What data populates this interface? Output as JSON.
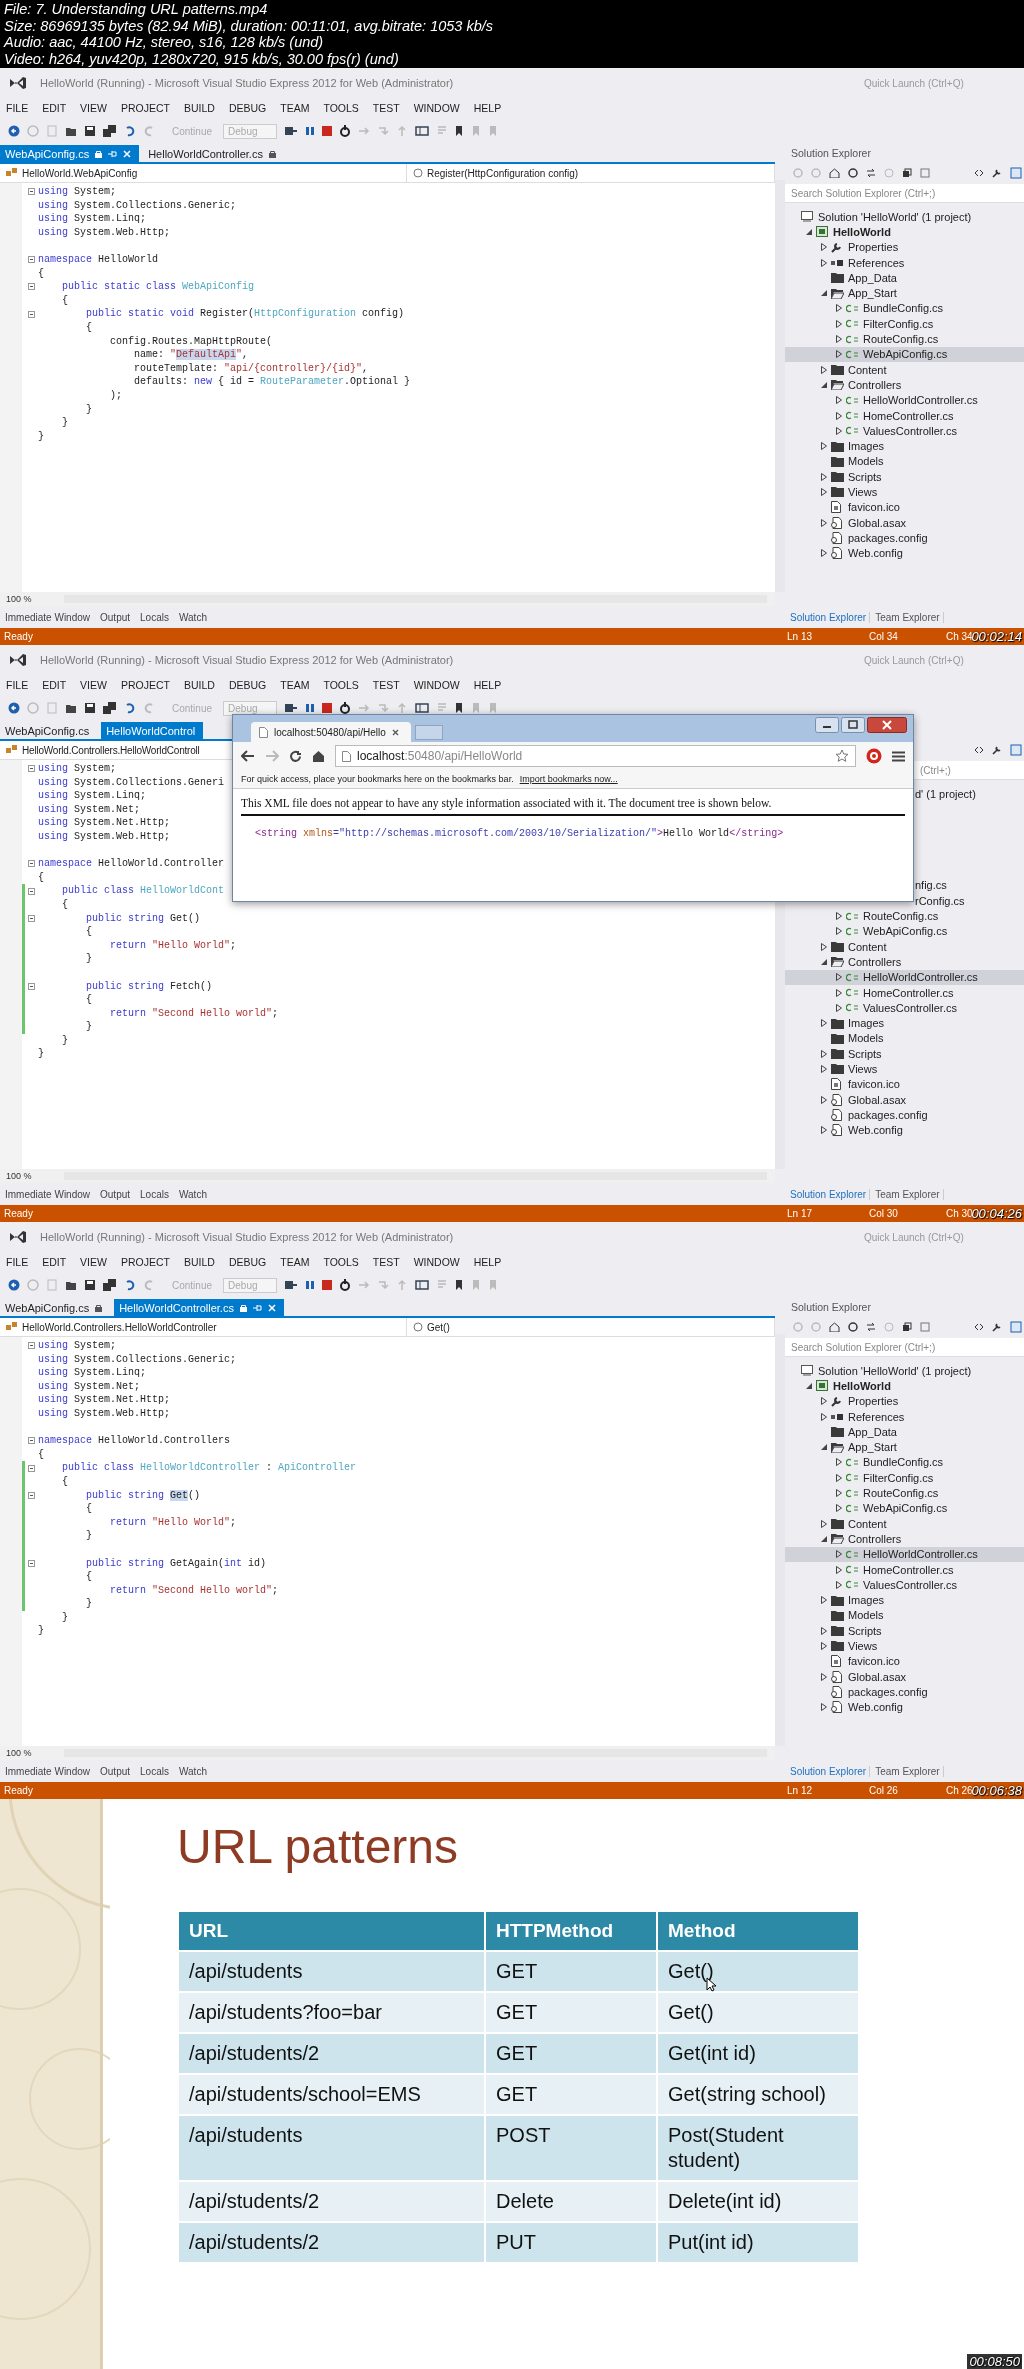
{
  "file_info": [
    "File: 7. Understanding URL patterns.mp4",
    "Size: 86969135 bytes (82.94 MiB), duration: 00:11:01, avg.bitrate: 1053 kb/s",
    "Audio: aac, 44100 Hz, stereo, s16, 128 kb/s (und)",
    "Video: h264, yuv420p, 1280x720, 915 kb/s, 30.00 fps(r) (und)"
  ],
  "frames": [
    {
      "title": "HelloWorld (Running) - Microsoft Visual Studio Express 2012 for Web (Administrator)",
      "quick_launch": {
        "placeholder": "Quick Launch (Ctrl+Q)"
      },
      "menu": [
        "FILE",
        "EDIT",
        "VIEW",
        "PROJECT",
        "BUILD",
        "DEBUG",
        "TEAM",
        "TOOLS",
        "TEST",
        "WINDOW",
        "HELP"
      ],
      "toolbar": {
        "continue": "Continue",
        "configuration": "Debug"
      },
      "tabs": [
        {
          "label": "WebApiConfig.cs",
          "selected": true
        },
        {
          "label": "HelloWorldController.cs",
          "selected": false
        }
      ],
      "nav": {
        "type": "HelloWorld.WebApiConfig",
        "member": "Register(HttpConfiguration config)"
      },
      "code": [
        {
          "kind": "code",
          "fold": true,
          "changed": false,
          "tokens": [
            {
              "kind": "keyword",
              "text": "using"
            },
            {
              "kind": "plain",
              "text": " System;"
            }
          ]
        },
        {
          "kind": "code",
          "fold": false,
          "changed": false,
          "tokens": [
            {
              "kind": "keyword",
              "text": "using"
            },
            {
              "kind": "plain",
              "text": " System.Collections.Generic;"
            }
          ]
        },
        {
          "kind": "code",
          "fold": false,
          "changed": false,
          "tokens": [
            {
              "kind": "keyword",
              "text": "using"
            },
            {
              "kind": "plain",
              "text": " System.Linq;"
            }
          ]
        },
        {
          "kind": "code",
          "fold": false,
          "changed": false,
          "tokens": [
            {
              "kind": "keyword",
              "text": "using"
            },
            {
              "kind": "plain",
              "text": " System.Web.Http;"
            }
          ]
        },
        {
          "kind": "blank",
          "changed": false
        },
        {
          "kind": "code",
          "fold": true,
          "changed": false,
          "tokens": [
            {
              "kind": "keyword",
              "text": "namespace"
            },
            {
              "kind": "plain",
              "text": " HelloWorld"
            }
          ]
        },
        {
          "kind": "code",
          "fold": false,
          "changed": false,
          "tokens": [
            {
              "kind": "plain",
              "text": "{"
            }
          ]
        },
        {
          "kind": "code",
          "fold": true,
          "changed": false,
          "tokens": [
            {
              "kind": "keyword",
              "text": "    public static class"
            },
            {
              "kind": "type",
              "text": " WebApiConfig"
            }
          ]
        },
        {
          "kind": "code",
          "fold": false,
          "changed": false,
          "tokens": [
            {
              "kind": "plain",
              "text": "    {"
            }
          ]
        },
        {
          "kind": "code",
          "fold": true,
          "changed": false,
          "tokens": [
            {
              "kind": "keyword",
              "text": "        public static void"
            },
            {
              "kind": "plain",
              "text": " Register("
            },
            {
              "kind": "type",
              "text": "HttpConfiguration"
            },
            {
              "kind": "plain",
              "text": " config)"
            }
          ]
        },
        {
          "kind": "code",
          "fold": false,
          "changed": false,
          "tokens": [
            {
              "kind": "plain",
              "text": "        {"
            }
          ]
        },
        {
          "kind": "code",
          "fold": false,
          "changed": false,
          "tokens": [
            {
              "kind": "plain",
              "text": "            config.Routes.MapHttpRoute("
            }
          ]
        },
        {
          "kind": "code",
          "fold": false,
          "changed": false,
          "tokens": [
            {
              "kind": "plain",
              "text": "                name: "
            },
            {
              "kind": "string",
              "text": "\""
            },
            {
              "kind": "string_highlight",
              "text": "DefaultApi"
            },
            {
              "kind": "string",
              "text": "\""
            },
            {
              "kind": "plain",
              "text": ","
            }
          ]
        },
        {
          "kind": "code",
          "fold": false,
          "changed": false,
          "tokens": [
            {
              "kind": "plain",
              "text": "                routeTemplate: "
            },
            {
              "kind": "string",
              "text": "\"api/{controller}/{id}\""
            },
            {
              "kind": "plain",
              "text": ","
            }
          ]
        },
        {
          "kind": "code",
          "fold": false,
          "changed": false,
          "tokens": [
            {
              "kind": "plain",
              "text": "                defaults: "
            },
            {
              "kind": "keyword",
              "text": "new"
            },
            {
              "kind": "plain",
              "text": " { id = "
            },
            {
              "kind": "type",
              "text": "RouteParameter"
            },
            {
              "kind": "plain",
              "text": ".Optional }"
            }
          ]
        },
        {
          "kind": "code",
          "fold": false,
          "changed": false,
          "tokens": [
            {
              "kind": "plain",
              "text": "            );"
            }
          ]
        },
        {
          "kind": "code",
          "fold": false,
          "changed": false,
          "tokens": [
            {
              "kind": "plain",
              "text": "        }"
            }
          ]
        },
        {
          "kind": "code",
          "fold": false,
          "changed": false,
          "tokens": [
            {
              "kind": "plain",
              "text": "    }"
            }
          ]
        },
        {
          "kind": "code",
          "fold": false,
          "changed": false,
          "tokens": [
            {
              "kind": "plain",
              "text": "}"
            }
          ]
        }
      ],
      "zoom": "100 %",
      "bottom_tabs": [
        "Immediate Window",
        "Output",
        "Locals",
        "Watch"
      ],
      "solution_explorer": {
        "title": "Solution Explorer",
        "search": {
          "placeholder": "Search Solution Explorer (Ctrl+;)"
        },
        "tree": [
          {
            "label": "Solution 'HelloWorld' (1 project)",
            "kind": "solution",
            "selected": false,
            "children": [
              {
                "label": "HelloWorld",
                "kind": "project",
                "expanded": true,
                "selected": false,
                "children": [
                  {
                    "label": "Properties",
                    "kind": "wrench",
                    "expanded": false,
                    "selected": false
                  },
                  {
                    "label": "References",
                    "kind": "references",
                    "expanded": false,
                    "selected": false
                  },
                  {
                    "label": "App_Data",
                    "kind": "folder",
                    "selected": false
                  },
                  {
                    "label": "App_Start",
                    "kind": "folder_open",
                    "expanded": true,
                    "selected": false,
                    "children": [
                      {
                        "label": "BundleConfig.cs",
                        "kind": "cs",
                        "expanded": false,
                        "selected": false
                      },
                      {
                        "label": "FilterConfig.cs",
                        "kind": "cs",
                        "expanded": false,
                        "selected": false
                      },
                      {
                        "label": "RouteConfig.cs",
                        "kind": "cs",
                        "expanded": false,
                        "selected": false
                      },
                      {
                        "label": "WebApiConfig.cs",
                        "kind": "cs",
                        "expanded": false,
                        "selected": true
                      }
                    ]
                  },
                  {
                    "label": "Content",
                    "kind": "folder",
                    "expanded": false,
                    "selected": false
                  },
                  {
                    "label": "Controllers",
                    "kind": "folder_open",
                    "expanded": true,
                    "selected": false,
                    "children": [
                      {
                        "label": "HelloWorldController.cs",
                        "kind": "cs",
                        "expanded": false,
                        "selected": false
                      },
                      {
                        "label": "HomeController.cs",
                        "kind": "cs",
                        "expanded": false,
                        "selected": false
                      },
                      {
                        "label": "ValuesController.cs",
                        "kind": "cs",
                        "expanded": false,
                        "selected": false
                      }
                    ]
                  },
                  {
                    "label": "Images",
                    "kind": "folder",
                    "expanded": false,
                    "selected": false
                  },
                  {
                    "label": "Models",
                    "kind": "folder",
                    "selected": false
                  },
                  {
                    "label": "Scripts",
                    "kind": "folder",
                    "expanded": false,
                    "selected": false
                  },
                  {
                    "label": "Views",
                    "kind": "folder",
                    "expanded": false,
                    "selected": false
                  },
                  {
                    "label": "favicon.ico",
                    "kind": "file",
                    "selected": false
                  },
                  {
                    "label": "Global.asax",
                    "kind": "config",
                    "expanded": false,
                    "selected": false
                  },
                  {
                    "label": "packages.config",
                    "kind": "config",
                    "selected": false
                  },
                  {
                    "label": "Web.config",
                    "kind": "config",
                    "expanded": false,
                    "selected": false
                  }
                ]
              }
            ]
          }
        ],
        "tabs": [
          {
            "label": "Solution Explorer",
            "selected": true
          },
          {
            "label": "Team Explorer",
            "selected": false
          }
        ]
      },
      "status": {
        "text": "Ready",
        "line": "Ln 13",
        "column": "Col 34",
        "char": "Ch 34"
      },
      "timestamp": "00:02:14"
    },
    {
      "title": "HelloWorld (Running) - Microsoft Visual Studio Express 2012 for Web (Administrator)",
      "quick_launch": {
        "placeholder": "Quick Launch (Ctrl+Q)"
      },
      "menu": [
        "FILE",
        "EDIT",
        "VIEW",
        "PROJECT",
        "BUILD",
        "DEBUG",
        "TEAM",
        "TOOLS",
        "TEST",
        "WINDOW",
        "HELP"
      ],
      "toolbar": {
        "continue": "Continue",
        "configuration": "Debug"
      },
      "tabs": [
        {
          "label": "WebApiConfig.cs",
          "selected": false
        },
        {
          "label": "HelloWorldControl",
          "selected": true
        }
      ],
      "nav": {
        "type": "HelloWorld.Controllers.HelloWorldControll"
      },
      "code": [
        {
          "kind": "code",
          "fold": true,
          "changed": false,
          "tokens": [
            {
              "kind": "keyword",
              "text": "using"
            },
            {
              "kind": "plain",
              "text": " System;"
            }
          ]
        },
        {
          "kind": "code",
          "fold": false,
          "changed": false,
          "tokens": [
            {
              "kind": "keyword",
              "text": "using"
            },
            {
              "kind": "plain",
              "text": " System.Collections.Generi"
            }
          ]
        },
        {
          "kind": "code",
          "fold": false,
          "changed": false,
          "tokens": [
            {
              "kind": "keyword",
              "text": "using"
            },
            {
              "kind": "plain",
              "text": " System.Linq;"
            }
          ]
        },
        {
          "kind": "code",
          "fold": false,
          "changed": false,
          "tokens": [
            {
              "kind": "keyword",
              "text": "using"
            },
            {
              "kind": "plain",
              "text": " System.Net;"
            }
          ]
        },
        {
          "kind": "code",
          "fold": false,
          "changed": false,
          "tokens": [
            {
              "kind": "keyword",
              "text": "using"
            },
            {
              "kind": "plain",
              "text": " System.Net.Http;"
            }
          ]
        },
        {
          "kind": "code",
          "fold": false,
          "changed": false,
          "tokens": [
            {
              "kind": "keyword",
              "text": "using"
            },
            {
              "kind": "plain",
              "text": " System.Web.Http;"
            }
          ]
        },
        {
          "kind": "blank",
          "changed": false
        },
        {
          "kind": "code",
          "fold": true,
          "changed": false,
          "tokens": [
            {
              "kind": "keyword",
              "text": "namespace"
            },
            {
              "kind": "plain",
              "text": " HelloWorld.Controller"
            }
          ]
        },
        {
          "kind": "code",
          "fold": false,
          "changed": false,
          "tokens": [
            {
              "kind": "plain",
              "text": "{"
            }
          ]
        },
        {
          "kind": "code",
          "fold": true,
          "changed": true,
          "tokens": [
            {
              "kind": "keyword",
              "text": "    public class"
            },
            {
              "kind": "type",
              "text": " HelloWorldCont"
            }
          ]
        },
        {
          "kind": "code",
          "fold": false,
          "changed": true,
          "tokens": [
            {
              "kind": "plain",
              "text": "    {"
            }
          ]
        },
        {
          "kind": "code",
          "fold": true,
          "changed": true,
          "tokens": [
            {
              "kind": "keyword",
              "text": "        public string"
            },
            {
              "kind": "plain",
              "text": " Get()"
            }
          ]
        },
        {
          "kind": "code",
          "fold": false,
          "changed": true,
          "tokens": [
            {
              "kind": "plain",
              "text": "        {"
            }
          ]
        },
        {
          "kind": "code",
          "fold": false,
          "changed": true,
          "tokens": [
            {
              "kind": "keyword",
              "text": "            return"
            },
            {
              "kind": "string",
              "text": " \"Hello World\""
            },
            {
              "kind": "plain",
              "text": ";"
            }
          ]
        },
        {
          "kind": "code",
          "fold": false,
          "changed": true,
          "tokens": [
            {
              "kind": "plain",
              "text": "        }"
            }
          ]
        },
        {
          "kind": "blank",
          "changed": true
        },
        {
          "kind": "code",
          "fold": true,
          "changed": true,
          "tokens": [
            {
              "kind": "keyword",
              "text": "        public string"
            },
            {
              "kind": "plain",
              "text": " Fetch()"
            }
          ]
        },
        {
          "kind": "code",
          "fold": false,
          "changed": true,
          "tokens": [
            {
              "kind": "plain",
              "text": "        {"
            }
          ]
        },
        {
          "kind": "code",
          "fold": false,
          "changed": true,
          "tokens": [
            {
              "kind": "keyword",
              "text": "            return"
            },
            {
              "kind": "string",
              "text": " \"Second Hello world\""
            },
            {
              "kind": "plain",
              "text": ";"
            }
          ]
        },
        {
          "kind": "code",
          "fold": false,
          "changed": true,
          "tokens": [
            {
              "kind": "plain",
              "text": "        }"
            }
          ]
        },
        {
          "kind": "code",
          "fold": false,
          "changed": false,
          "tokens": [
            {
              "kind": "plain",
              "text": "    }"
            }
          ]
        },
        {
          "kind": "code",
          "fold": false,
          "changed": false,
          "tokens": [
            {
              "kind": "plain",
              "text": "}"
            }
          ]
        }
      ],
      "zoom": "100 %",
      "bottom_tabs": [
        "Immediate Window",
        "Output",
        "Locals",
        "Watch"
      ],
      "solution_explorer": {
        "search": {
          "placeholder": "(Ctrl+;)"
        },
        "tree": [
          {
            "label": "d' (1 project)",
            "kind": "cut",
            "children": [
              {
                "kind": "hidden",
                "children": [
                  {
                    "kind": "hidden"
                  },
                  {
                    "kind": "hidden"
                  },
                  {
                    "kind": "hidden"
                  },
                  {
                    "kind": "hidden",
                    "children": [
                      {
                        "label": "nfig.cs",
                        "kind": "cut"
                      },
                      {
                        "label": "rConfig.cs",
                        "kind": "cut"
                      },
                      {
                        "label": "RouteConfig.cs",
                        "kind": "cs",
                        "expanded": false,
                        "selected": false
                      },
                      {
                        "label": "WebApiConfig.cs",
                        "kind": "cs",
                        "expanded": false,
                        "selected": false
                      }
                    ]
                  },
                  {
                    "label": "Content",
                    "kind": "folder",
                    "expanded": false,
                    "selected": false
                  },
                  {
                    "label": "Controllers",
                    "kind": "folder_open",
                    "expanded": true,
                    "selected": false,
                    "children": [
                      {
                        "label": "HelloWorldController.cs",
                        "kind": "cs",
                        "expanded": false,
                        "selected": true
                      },
                      {
                        "label": "HomeController.cs",
                        "kind": "cs",
                        "expanded": false,
                        "selected": false
                      },
                      {
                        "label": "ValuesController.cs",
                        "kind": "cs",
                        "expanded": false,
                        "selected": false
                      }
                    ]
                  },
                  {
                    "label": "Images",
                    "kind": "folder",
                    "expanded": false,
                    "selected": false
                  },
                  {
                    "label": "Models",
                    "kind": "folder",
                    "selected": false
                  },
                  {
                    "label": "Scripts",
                    "kind": "folder",
                    "expanded": false,
                    "selected": false
                  },
                  {
                    "label": "Views",
                    "kind": "folder",
                    "expanded": false,
                    "selected": false
                  },
                  {
                    "label": "favicon.ico",
                    "kind": "file",
                    "selected": false
                  },
                  {
                    "label": "Global.asax",
                    "kind": "config",
                    "expanded": false,
                    "selected": false
                  },
                  {
                    "label": "packages.config",
                    "kind": "config",
                    "selected": false
                  },
                  {
                    "label": "Web.config",
                    "kind": "config",
                    "expanded": false,
                    "selected": false
                  }
                ]
              }
            ]
          }
        ],
        "tabs": [
          {
            "label": "Solution Explorer",
            "selected": true
          },
          {
            "label": "Team Explorer",
            "selected": false
          }
        ]
      },
      "status": {
        "text": "Ready",
        "line": "Ln 17",
        "column": "Col 30",
        "char": "Ch 30"
      },
      "timestamp": "00:04:26",
      "popup": {
        "tab": "localhost:50480/api/Hello",
        "address_host": "localhost",
        "address_path": ":50480/api/HelloWorld",
        "bookmarks_hint": "For quick access, place your bookmarks here on the bookmarks bar.",
        "bookmarks_link": "Import bookmarks now...",
        "message": "This XML file does not appear to have any style information associated with it. The document tree is shown below.",
        "xml": [
          {
            "kind": "tag",
            "text": "<string "
          },
          {
            "kind": "attr",
            "text": "xmlns"
          },
          {
            "kind": "value",
            "text": "=\"http://schemas.microsoft.com/2003/10/Serialization/\""
          },
          {
            "kind": "tag",
            "text": ">"
          },
          {
            "kind": "text",
            "text": "Hello World"
          },
          {
            "kind": "tag",
            "text": "</string>"
          }
        ]
      }
    },
    {
      "title": "HelloWorld (Running) - Microsoft Visual Studio Express 2012 for Web (Administrator)",
      "quick_launch": {
        "placeholder": "Quick Launch (Ctrl+Q)"
      },
      "menu": [
        "FILE",
        "EDIT",
        "VIEW",
        "PROJECT",
        "BUILD",
        "DEBUG",
        "TEAM",
        "TOOLS",
        "TEST",
        "WINDOW",
        "HELP"
      ],
      "toolbar": {
        "continue": "Continue",
        "configuration": "Debug"
      },
      "tabs": [
        {
          "label": "WebApiConfig.cs",
          "selected": false
        },
        {
          "label": "HelloWorldController.cs",
          "selected": true
        }
      ],
      "nav": {
        "type": "HelloWorld.Controllers.HelloWorldController",
        "member": "Get()"
      },
      "code": [
        {
          "kind": "code",
          "fold": true,
          "changed": false,
          "tokens": [
            {
              "kind": "keyword",
              "text": "using"
            },
            {
              "kind": "plain",
              "text": " System;"
            }
          ]
        },
        {
          "kind": "code",
          "fold": false,
          "changed": false,
          "tokens": [
            {
              "kind": "keyword",
              "text": "using"
            },
            {
              "kind": "plain",
              "text": " System.Collections.Generic;"
            }
          ]
        },
        {
          "kind": "code",
          "fold": false,
          "changed": false,
          "tokens": [
            {
              "kind": "keyword",
              "text": "using"
            },
            {
              "kind": "plain",
              "text": " System.Linq;"
            }
          ]
        },
        {
          "kind": "code",
          "fold": false,
          "changed": false,
          "tokens": [
            {
              "kind": "keyword",
              "text": "using"
            },
            {
              "kind": "plain",
              "text": " System.Net;"
            }
          ]
        },
        {
          "kind": "code",
          "fold": false,
          "changed": false,
          "tokens": [
            {
              "kind": "keyword",
              "text": "using"
            },
            {
              "kind": "plain",
              "text": " System.Net.Http;"
            }
          ]
        },
        {
          "kind": "code",
          "fold": false,
          "changed": false,
          "tokens": [
            {
              "kind": "keyword",
              "text": "using"
            },
            {
              "kind": "plain",
              "text": " System.Web.Http;"
            }
          ]
        },
        {
          "kind": "blank",
          "changed": false
        },
        {
          "kind": "code",
          "fold": true,
          "changed": false,
          "tokens": [
            {
              "kind": "keyword",
              "text": "namespace"
            },
            {
              "kind": "plain",
              "text": " HelloWorld.Controllers"
            }
          ]
        },
        {
          "kind": "code",
          "fold": false,
          "changed": false,
          "tokens": [
            {
              "kind": "plain",
              "text": "{"
            }
          ]
        },
        {
          "kind": "code",
          "fold": true,
          "changed": true,
          "tokens": [
            {
              "kind": "keyword",
              "text": "    public class"
            },
            {
              "kind": "type",
              "text": " HelloWorldController"
            },
            {
              "kind": "plain",
              "text": " : "
            },
            {
              "kind": "type",
              "text": "ApiController"
            }
          ]
        },
        {
          "kind": "code",
          "fold": false,
          "changed": true,
          "tokens": [
            {
              "kind": "plain",
              "text": "    {"
            }
          ]
        },
        {
          "kind": "code",
          "fold": true,
          "changed": true,
          "tokens": [
            {
              "kind": "keyword",
              "text": "        public string "
            },
            {
              "kind": "highlight",
              "text": "Get"
            },
            {
              "kind": "plain",
              "text": "()"
            }
          ]
        },
        {
          "kind": "code",
          "fold": false,
          "changed": true,
          "tokens": [
            {
              "kind": "plain",
              "text": "        {"
            }
          ]
        },
        {
          "kind": "code",
          "fold": false,
          "changed": true,
          "tokens": [
            {
              "kind": "keyword",
              "text": "            return"
            },
            {
              "kind": "string",
              "text": " \"Hello World\""
            },
            {
              "kind": "plain",
              "text": ";"
            }
          ]
        },
        {
          "kind": "code",
          "fold": false,
          "changed": true,
          "tokens": [
            {
              "kind": "plain",
              "text": "        }"
            }
          ]
        },
        {
          "kind": "blank",
          "changed": true
        },
        {
          "kind": "code",
          "fold": true,
          "changed": true,
          "tokens": [
            {
              "kind": "keyword",
              "text": "        public string"
            },
            {
              "kind": "plain",
              "text": " GetAgain("
            },
            {
              "kind": "keyword",
              "text": "int"
            },
            {
              "kind": "plain",
              "text": " id)"
            }
          ]
        },
        {
          "kind": "code",
          "fold": false,
          "changed": true,
          "tokens": [
            {
              "kind": "plain",
              "text": "        {"
            }
          ]
        },
        {
          "kind": "code",
          "fold": false,
          "changed": true,
          "tokens": [
            {
              "kind": "keyword",
              "text": "            return"
            },
            {
              "kind": "string",
              "text": " \"Second Hello world\""
            },
            {
              "kind": "plain",
              "text": ";"
            }
          ]
        },
        {
          "kind": "code",
          "fold": false,
          "changed": true,
          "tokens": [
            {
              "kind": "plain",
              "text": "        }"
            }
          ]
        },
        {
          "kind": "code",
          "fold": false,
          "changed": false,
          "tokens": [
            {
              "kind": "plain",
              "text": "    }"
            }
          ]
        },
        {
          "kind": "code",
          "fold": false,
          "changed": false,
          "tokens": [
            {
              "kind": "plain",
              "text": "}"
            }
          ]
        }
      ],
      "zoom": "100 %",
      "bottom_tabs": [
        "Immediate Window",
        "Output",
        "Locals",
        "Watch"
      ],
      "solution_explorer": {
        "title": "Solution Explorer",
        "search": {
          "placeholder": "Search Solution Explorer (Ctrl+;)"
        },
        "tree": [
          {
            "label": "Solution 'HelloWorld' (1 project)",
            "kind": "solution",
            "selected": false,
            "children": [
              {
                "label": "HelloWorld",
                "kind": "project",
                "expanded": true,
                "selected": false,
                "children": [
                  {
                    "label": "Properties",
                    "kind": "wrench",
                    "expanded": false,
                    "selected": false
                  },
                  {
                    "label": "References",
                    "kind": "references",
                    "expanded": false,
                    "selected": false
                  },
                  {
                    "label": "App_Data",
                    "kind": "folder",
                    "selected": false
                  },
                  {
                    "label": "App_Start",
                    "kind": "folder_open",
                    "expanded": true,
                    "selected": false,
                    "children": [
                      {
                        "label": "BundleConfig.cs",
                        "kind": "cs",
                        "expanded": false,
                        "selected": false
                      },
                      {
                        "label": "FilterConfig.cs",
                        "kind": "cs",
                        "expanded": false,
                        "selected": false
                      },
                      {
                        "label": "RouteConfig.cs",
                        "kind": "cs",
                        "expanded": false,
                        "selected": false
                      },
                      {
                        "label": "WebApiConfig.cs",
                        "kind": "cs",
                        "expanded": false,
                        "selected": false
                      }
                    ]
                  },
                  {
                    "label": "Content",
                    "kind": "folder",
                    "expanded": false,
                    "selected": false
                  },
                  {
                    "label": "Controllers",
                    "kind": "folder_open",
                    "expanded": true,
                    "selected": false,
                    "children": [
                      {
                        "label": "HelloWorldController.cs",
                        "kind": "cs",
                        "expanded": false,
                        "selected": true
                      },
                      {
                        "label": "HomeController.cs",
                        "kind": "cs",
                        "expanded": false,
                        "selected": false
                      },
                      {
                        "label": "ValuesController.cs",
                        "kind": "cs",
                        "expanded": false,
                        "selected": false
                      }
                    ]
                  },
                  {
                    "label": "Images",
                    "kind": "folder",
                    "expanded": false,
                    "selected": false
                  },
                  {
                    "label": "Models",
                    "kind": "folder",
                    "selected": false
                  },
                  {
                    "label": "Scripts",
                    "kind": "folder",
                    "expanded": false,
                    "selected": false
                  },
                  {
                    "label": "Views",
                    "kind": "folder",
                    "expanded": false,
                    "selected": false
                  },
                  {
                    "label": "favicon.ico",
                    "kind": "file",
                    "selected": false
                  },
                  {
                    "label": "Global.asax",
                    "kind": "config",
                    "expanded": false,
                    "selected": false
                  },
                  {
                    "label": "packages.config",
                    "kind": "config",
                    "selected": false
                  },
                  {
                    "label": "Web.config",
                    "kind": "config",
                    "expanded": false,
                    "selected": false
                  }
                ]
              }
            ]
          }
        ],
        "tabs": [
          {
            "label": "Solution Explorer",
            "selected": true
          },
          {
            "label": "Team Explorer",
            "selected": false
          }
        ]
      },
      "status": {
        "text": "Ready",
        "line": "Ln 12",
        "column": "Col 26",
        "char": "Ch 26"
      },
      "timestamp": "00:06:38"
    }
  ],
  "slide": {
    "title": "URL patterns",
    "table": {
      "columns": [
        "URL",
        "HTTPMethod",
        "Method"
      ],
      "rows": [
        [
          "/api/students",
          "GET",
          "Get()"
        ],
        [
          "/api/students?foo=bar",
          "GET",
          "Get()"
        ],
        [
          "/api/students/2",
          "GET",
          "Get(int id)"
        ],
        [
          "/api/students/school=EMS",
          "GET",
          "Get(string school)"
        ],
        [
          "/api/students",
          "POST",
          "Post(Student student)"
        ],
        [
          "/api/students/2",
          "Delete",
          "Delete(int id)"
        ],
        [
          "/api/students/2",
          "PUT",
          "Put(int id)"
        ]
      ]
    },
    "timestamp": "00:08:50"
  }
}
